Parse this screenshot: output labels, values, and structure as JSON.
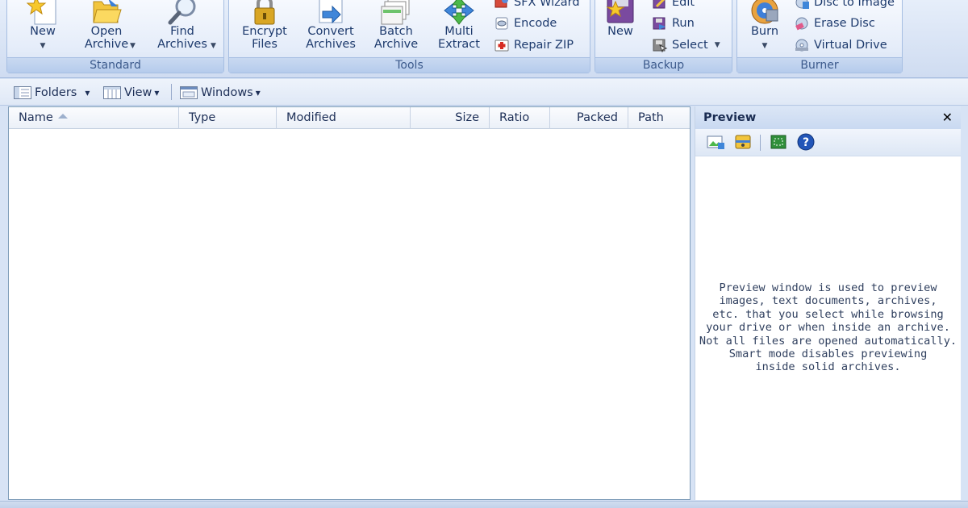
{
  "ribbon": {
    "standard": {
      "label": "Standard",
      "new": "New",
      "open": "Open\nArchive",
      "find": "Find\nArchives"
    },
    "tools": {
      "label": "Tools",
      "encrypt": "Encrypt\nFiles",
      "convert": "Convert\nArchives",
      "batch": "Batch\nArchive",
      "multi": "Multi\nExtract",
      "sfx": "SFX Wizard",
      "encode": "Encode",
      "repair": "Repair ZIP"
    },
    "backup": {
      "label": "Backup",
      "new": "New",
      "edit": "Edit",
      "run": "Run",
      "select": "Select"
    },
    "burner": {
      "label": "Burner",
      "burn": "Burn",
      "disc_to_image": "Disc to Image",
      "erase_disc": "Erase Disc",
      "virtual_drive": "Virtual Drive"
    }
  },
  "toolbar": {
    "folders": "Folders",
    "view": "View",
    "windows": "Windows"
  },
  "filelist": {
    "columns": [
      "Name",
      "Type",
      "Modified",
      "Size",
      "Ratio",
      "Packed",
      "Path"
    ]
  },
  "preview": {
    "title": "Preview",
    "close_glyph": "✕",
    "message": "Preview window is used to preview\nimages, text documents, archives,\netc. that you select while browsing\nyour drive or when inside an archive.\nNot all files are opened automatically.\nSmart mode disables previewing\ninside solid archives."
  },
  "icons": {
    "caret": "▼",
    "dropdown": "▾"
  },
  "colors": {
    "accent": "#3c5a8c",
    "ribbon_bg": "#e4ecf9",
    "border": "#7f9db9"
  }
}
